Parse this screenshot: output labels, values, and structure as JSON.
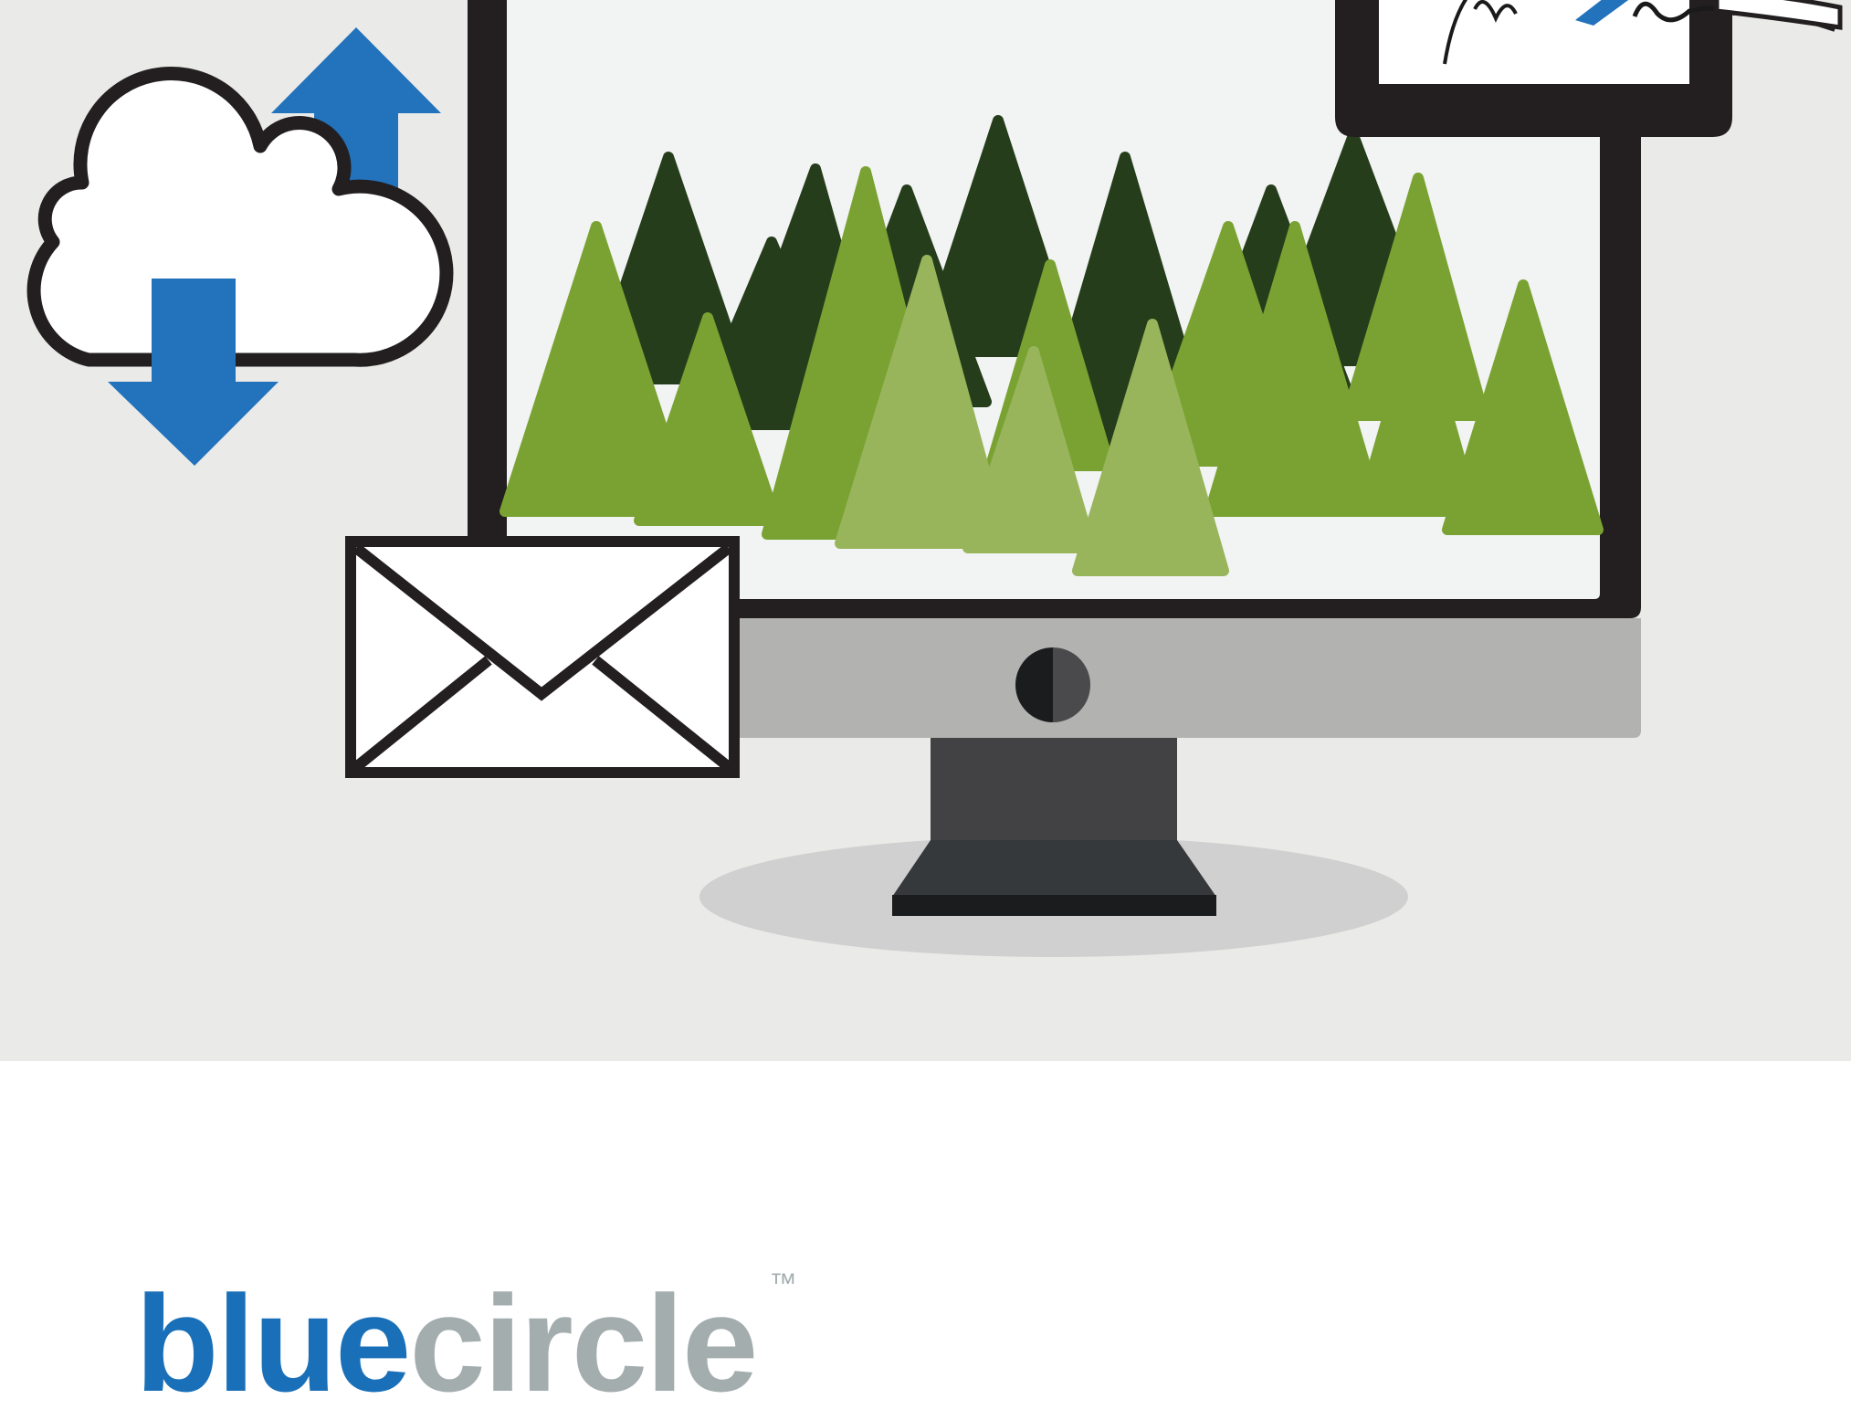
{
  "colors": {
    "background_band": "#eaeae8",
    "monitor_frame": "#231f20",
    "screen": "#f2f3f3",
    "chin": "#b2b2b0",
    "stand": "#424244",
    "stand_base": "#35393c",
    "stand_shadow": "#d0d0d0",
    "cloud_arrows": "#2272bc",
    "tree_dark": "#253d1b",
    "tree_mid": "#7aa232",
    "tree_light": "#98b55c",
    "logo_blue": "#1a70b8",
    "logo_gray": "#a4adae"
  },
  "icons": [
    "cloud-sync-icon",
    "envelope-icon",
    "signature-document-icon",
    "desktop-monitor-icon"
  ],
  "logo": {
    "part1": "blue",
    "part2": "circle",
    "trademark": "™"
  }
}
